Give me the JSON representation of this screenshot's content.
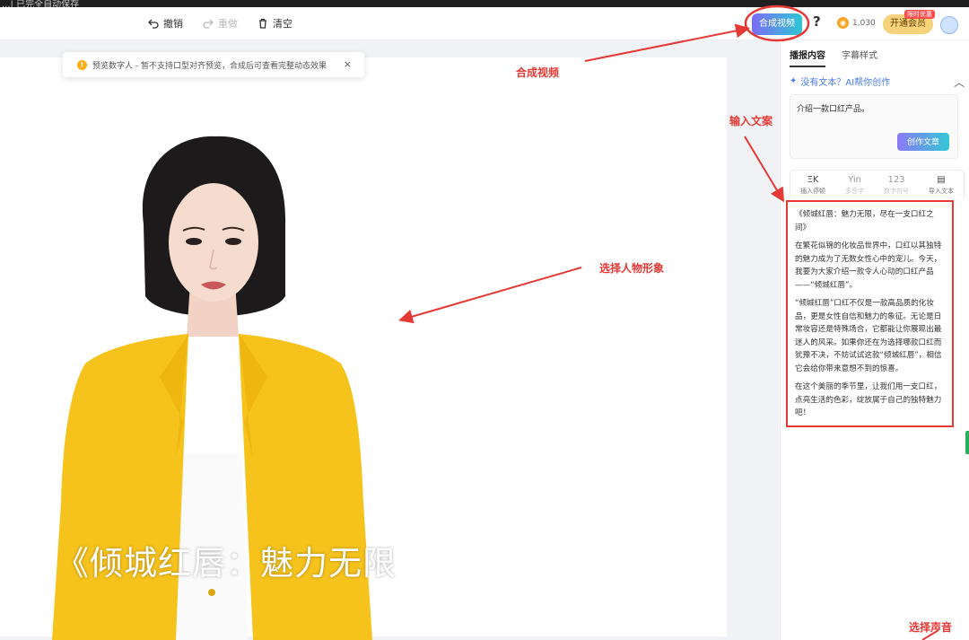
{
  "window": {
    "title": "...| 已完全自动保存"
  },
  "toolbar": {
    "undo": "撤销",
    "redo": "重做",
    "clear": "清空",
    "compose_video": "合成视频",
    "help": "?",
    "coins": "1,030",
    "open_vip": "开通会员",
    "vip_badge": "限时优惠"
  },
  "notice": {
    "text": "预览数字人 - 暂不支持口型对齐预览，合成后可查看完整动态效果",
    "close": "×"
  },
  "canvas": {
    "subtitle": "《倾城红唇：魅力无限"
  },
  "panel": {
    "tabs": [
      {
        "label": "播报内容",
        "active": true
      },
      {
        "label": "字幕样式",
        "active": false
      }
    ],
    "ai_hint": "没有文本？AI帮你创作",
    "prompt": "介绍一款口红产品。",
    "create_button": "创作文章",
    "tools": [
      {
        "label": "插入停顿",
        "icon": "ΞK"
      },
      {
        "label": "多音字",
        "icon": "Yin"
      },
      {
        "label": "数字符号",
        "icon": "123"
      },
      {
        "label": "导入文本",
        "icon": "▤"
      }
    ],
    "script_paragraphs": [
      "《倾城红唇：魅力无限，尽在一支口红之间》",
      "在繁花似锦的化妆品世界中，口红以其独特的魅力成为了无数女性心中的宠儿。今天，我要为大家介绍一款令人心动的口红产品——“倾城红唇”。",
      "“倾城红唇”口红不仅是一款高品质的化妆品，更是女性自信和魅力的象征。无论是日常妆容还是特殊场合，它都能让你展现出最迷人的风采。如果你还在为选择哪款口红而犹豫不决，不妨试试这款“倾城红唇”，相信它会给你带来意想不到的惊喜。",
      "在这个美丽的季节里，让我们用一支口红，点亮生活的色彩，绽放属于自己的独特魅力吧！"
    ]
  },
  "annotations": {
    "compose": "合成视频",
    "input_text": "输入文案",
    "choose_avatar": "选择人物形象",
    "choose_voice": "选择声音"
  },
  "colors": {
    "accent_red": "#e53935",
    "compose_gradient_start": "#7b6cf6",
    "compose_gradient_end": "#2ec7d3",
    "jacket_yellow": "#f6c21c"
  }
}
